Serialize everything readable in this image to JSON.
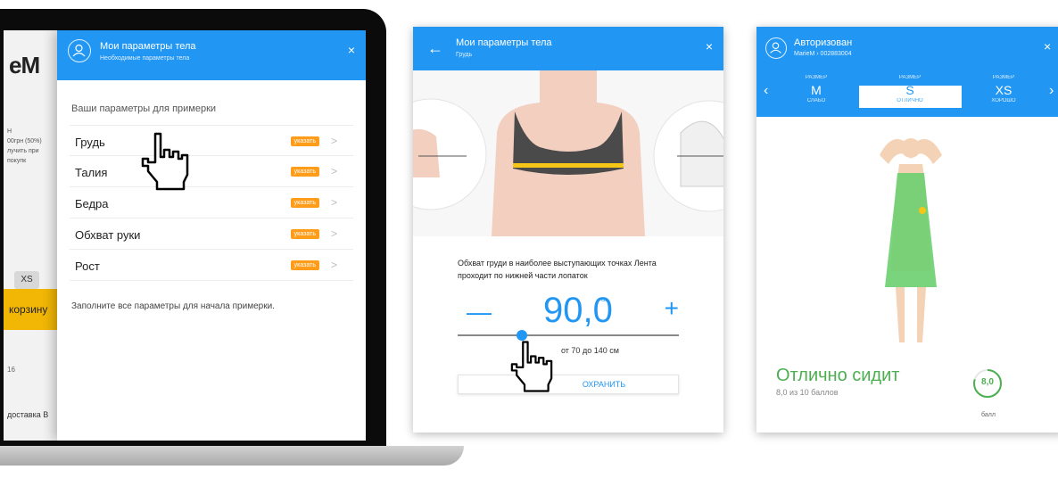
{
  "laptop": {
    "background_site": {
      "logo": "eM",
      "price_lines": [
        "Н",
        "00грн (50%)",
        "лучить при покупк"
      ],
      "size_button": "XS",
      "cart_button": "корзину",
      "date": "16",
      "tabs": "доставка   В"
    },
    "modal": {
      "title": "Мои параметры тела",
      "subtitle": "Необходимые параметры тела",
      "close": "×",
      "section_title": "Ваши параметры для примерки",
      "params": [
        {
          "label": "Грудь",
          "badge": "указать",
          "chevron": ">"
        },
        {
          "label": "Талия",
          "badge": "указать",
          "chevron": ">"
        },
        {
          "label": "Бедра",
          "badge": "указать",
          "chevron": ">"
        },
        {
          "label": "Обхват руки",
          "badge": "указать",
          "chevron": ">"
        },
        {
          "label": "Рост",
          "badge": "указать",
          "chevron": ">"
        }
      ],
      "hint": "Заполните все параметры для начала примерки."
    }
  },
  "measure_screen": {
    "back": "←",
    "title": "Мои параметры тела",
    "subtitle": "Грудь",
    "close": "×",
    "description": "Обхват груди в наиболее выступающих точках Лента проходит по нижней части лопаток",
    "minus": "—",
    "plus": "+",
    "value": "90,0",
    "unit": "см",
    "slider_fraction": 0.29,
    "range_text": "от 70 до 140  см",
    "save_label": "ОХРАНИТЬ"
  },
  "fitting_screen": {
    "title": "Авторизован",
    "subtitle": "MarieM  ›  002883004",
    "close": "×",
    "prev": "‹",
    "next": "›",
    "sizes": [
      {
        "label": "РАЗМЕР",
        "size": "M",
        "fit": "СЛАБО"
      },
      {
        "label": "РАЗМЕР",
        "size": "S",
        "fit": "ОТЛИЧНО"
      },
      {
        "label": "РАЗМЕР",
        "size": "XS",
        "fit": "ХОРОШО"
      }
    ],
    "fit_result": "Отлично сидит",
    "score_text": "8,0 из 10 баллов",
    "score_value": "8,0",
    "score_fraction": 0.8,
    "score_unit": "балл",
    "colors": {
      "accent": "#2196f3",
      "good": "#4caf50",
      "badge": "#ff9c1a"
    }
  }
}
